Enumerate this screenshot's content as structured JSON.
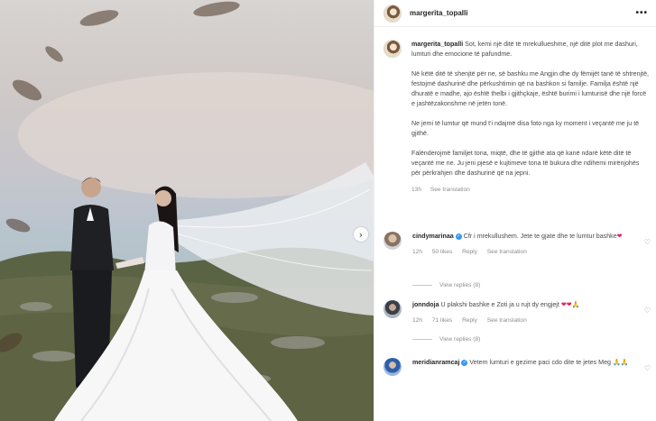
{
  "post": {
    "username": "margerita_topalli",
    "more_label": "•••",
    "caption_paragraphs": [
      "Sot, kemi një ditë të mrekullueshme, një ditë plot me dashuri, lumturi dhe emocione të pafundme.",
      "Në këtë ditë të shenjtë për ne, së bashku me Angjin dhe dy fëmijët tanë të shtrenjtë, festojmë dashurinë dhe përkushtimin që na bashkon si familje. Familja është një dhuratë e madhe, ajo është thelbi i gjithçkaje, është burimi i lumturisë dhe një forcë e jashtëzakonshme në jetën tonë.",
      "Ne jemi të lumtur që mund t'i ndajmë disa foto nga ky moment i veçantë me ju të gjithë.",
      "Falënderojmë familjet tona, miqtë, dhe të gjithë ata që kanë ndarë këtë ditë të veçantë me ne. Ju jeni pjesë e kujtimeve tona të bukura dhe ndihemi mirënjohës për përkrahjen dhe dashurinë që na jepni."
    ],
    "caption_time": "13h",
    "see_translation": "See translation"
  },
  "comments": [
    {
      "username": "cindymarinaa",
      "text": "Cfr i mrekullushem. Jete te gjate dhe te lumtur bashke",
      "emoji": "❤",
      "time": "12h",
      "likes": "50 likes",
      "reply": "Reply",
      "see_translation": "See translation",
      "view_replies": "View replies (8)"
    },
    {
      "username": "jonndoja",
      "text": "U plakshi bashke e Zoti ja u rujt dy engjejt",
      "emoji": "❤❤",
      "time": "12h",
      "likes": "71 likes",
      "reply": "Reply",
      "see_translation": "See translation",
      "view_replies": "View replies (8)"
    },
    {
      "username": "meridianramcaj",
      "text": "Vetem lumturi e gezime paci cdo dite te jetes Meg",
      "emoji": "",
      "time": "",
      "likes": "",
      "reply": "",
      "see_translation": "",
      "view_replies": ""
    }
  ],
  "icons": {
    "verified": "✓",
    "heart": "♡",
    "next": "›"
  }
}
